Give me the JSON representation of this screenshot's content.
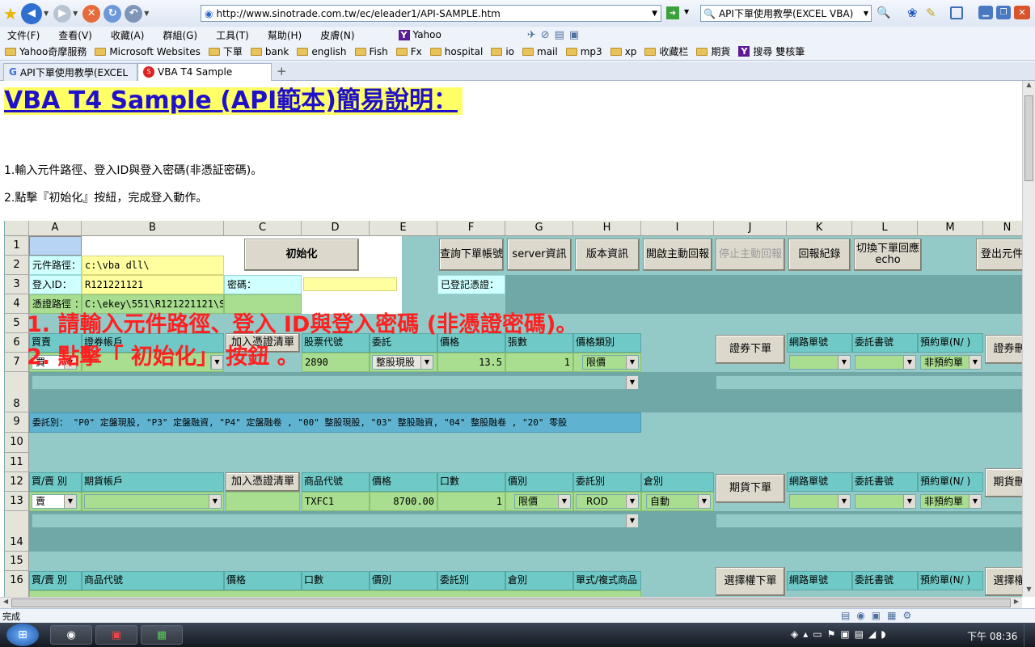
{
  "browser": {
    "url": "http://www.sinotrade.com.tw/ec/eleader1/API-SAMPLE.htm",
    "search": "API下單使用教學(EXCEL VBA)",
    "menu": [
      "文件(F)",
      "查看(V)",
      "收藏(A)",
      "群組(G)",
      "工具(T)",
      "幫助(H)",
      "皮膚(N)"
    ],
    "yahoo": "Yahoo",
    "favorites": [
      "Yahoo奇摩服務",
      "Microsoft Websites",
      "下單",
      "bank",
      "english",
      "Fish",
      "Fx",
      "hospital",
      "io",
      "mail",
      "mp3",
      "xp",
      "收藏栏",
      "期貨"
    ],
    "fav_search": "搜尋 雙核筆",
    "tabs": [
      "API下單使用教學(EXCEL",
      "VBA T4 Sample"
    ],
    "status": "完成",
    "clock": "下午 08:36"
  },
  "page": {
    "title": "VBA T4 Sample (API範本)簡易說明：",
    "step1": "1.輸入元件路徑、登入ID與登入密碼(非憑証密碼)。",
    "step2": "2.點擊『初始化』按紐，完成登入動作。",
    "overlay1": "1. 請輸入元件路徑、登入 ID與登入密碼 (非憑證密碼)。",
    "overlay2": "2. 點擊「 初始化」 按鈕 。"
  },
  "sheet": {
    "cols": [
      "A",
      "B",
      "C",
      "D",
      "E",
      "F",
      "G",
      "H",
      "I",
      "J",
      "K",
      "L",
      "M",
      "N"
    ],
    "rows": [
      "1",
      "2",
      "3",
      "4",
      "5",
      "6",
      "7",
      "8",
      "9",
      "10",
      "11",
      "12",
      "13",
      "14",
      "15",
      "16"
    ],
    "b_init": "初始化",
    "path_label": "元件路徑：",
    "path_value": "c:\\vba dll\\",
    "id_label": "登入ID：",
    "id_value": "R121221121",
    "pw_label": "密碼：",
    "cert_label": "憑證路徑 ：",
    "cert_value": "C:\\ekey\\551\\R121221121\\S",
    "registered": "已登記憑證：",
    "b_query": "查詢下單帳號",
    "b_server": "server資訊",
    "b_version": "版本資訊",
    "b_start": "開啟主動回報",
    "b_stop": "停止主動回報",
    "b_record": "回報紀錄",
    "b_echo": "切換下單回應 echo",
    "b_logout": "登出元件",
    "r6": [
      "買賣",
      "證券帳戶",
      "加入憑證清單",
      "股票代號",
      "委託",
      "價格",
      "張數",
      "價格類別"
    ],
    "r7": {
      "side": "買",
      "stock": "2890",
      "order": "整股現股",
      "price": "13.5",
      "qty": "1",
      "ptype": "限價",
      "rtype": "非預約單"
    },
    "b_stock": "證券下單",
    "b_stock_n": "證券刪",
    "net": "網路單號",
    "doc": "委託書號",
    "pre": "預約單(N/ )",
    "r9": "委託別：  \"P0\" 定盤現股, \"P3\" 定盤融資, \"P4\" 定盤融卷 , \"00\" 整股現股, \"03\" 整股融資, \"04\" 整股融卷 , \"20\" 零股",
    "r12": [
      "買/賣 別",
      "期貨帳戶",
      "加入憑證清單",
      "商品代號",
      "價格",
      "口數",
      "價別",
      "委託別",
      "倉別"
    ],
    "r13": {
      "side": "賣",
      "code": "TXFC1",
      "price": "8700.00",
      "qty": "1",
      "ptype": "限價",
      "otype": "ROD",
      "pos": "自動",
      "rtype": "非預約單"
    },
    "b_fut": "期貨下單",
    "b_fut_n": "期貨刪",
    "r16": [
      "買/賣 別",
      "商品代號",
      "價格",
      "口數",
      "價別",
      "委託別",
      "倉別",
      "單式/複式商品"
    ],
    "b_opt": "選擇權下單",
    "b_opt_n": "選擇權"
  }
}
